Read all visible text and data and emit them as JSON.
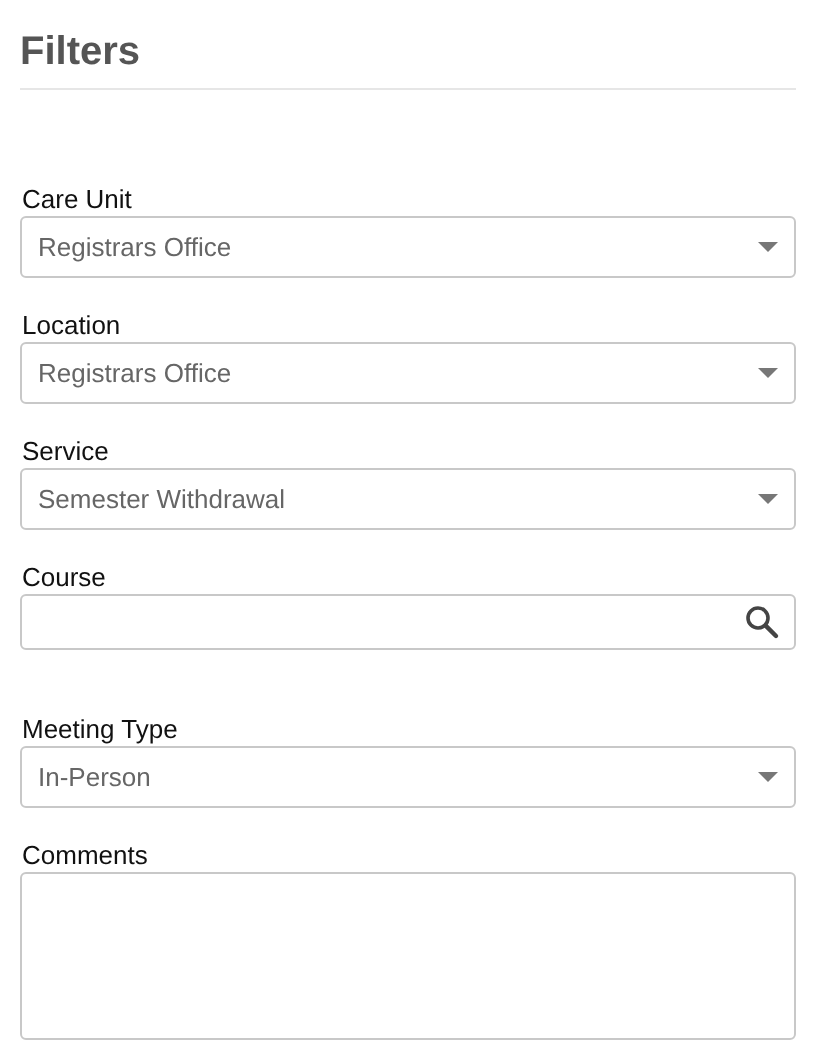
{
  "title": "Filters",
  "fields": [
    {
      "kind": "select",
      "label": "Care Unit",
      "value": "Registrars Office"
    },
    {
      "kind": "select",
      "label": "Location",
      "value": "Registrars Office"
    },
    {
      "kind": "select",
      "label": "Service",
      "value": "Semester Withdrawal"
    },
    {
      "kind": "search",
      "label": "Course"
    },
    {
      "kind": "select",
      "label": "Meeting Type",
      "value": "In-Person"
    },
    {
      "kind": "textarea",
      "label": "Comments"
    }
  ]
}
